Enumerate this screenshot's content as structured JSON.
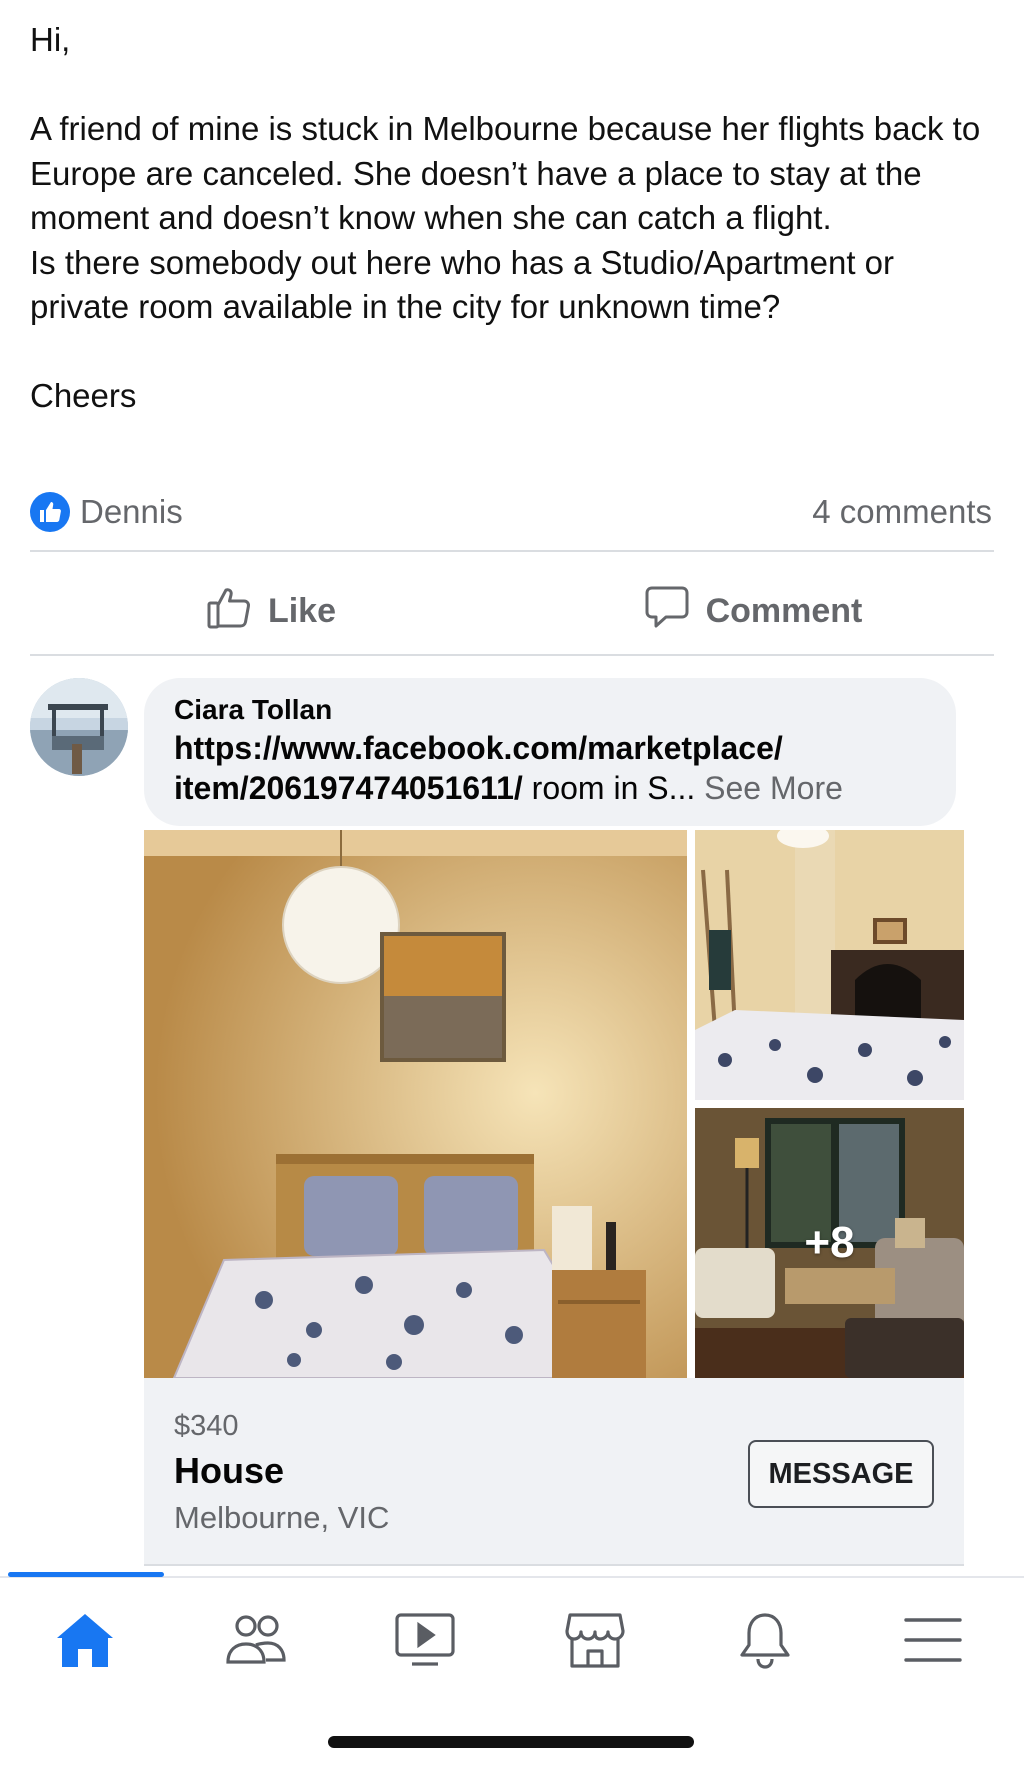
{
  "post": {
    "paragraphs": [
      "Hi,",
      "",
      "A friend of mine is stuck in Melbourne because her flights back to Europe are canceled. She doesn’t have a place to stay at the moment and doesn’t know when she can catch a flight.",
      "Is there somebody out here who has a Studio/Apartment or private room available in the city for unknown time?",
      "",
      "Cheers"
    ]
  },
  "reactions": {
    "reactor": "Dennis",
    "comment_count": "4 comments"
  },
  "actions": {
    "like_label": "Like",
    "comment_label": "Comment"
  },
  "comment": {
    "author": "Ciara Tollan",
    "link_line1": "https://www.facebook.com/marketplace/",
    "link_line2": "item/206197474051611/",
    "snippet": " room in S...",
    "see_more": "See More"
  },
  "gallery": {
    "more_count": "+8"
  },
  "listing": {
    "price": "$340",
    "title": "House",
    "location": "Melbourne, VIC",
    "message_label": "MESSAGE"
  },
  "tabbar": {
    "active_color": "#1877f2",
    "icons": [
      "home-icon",
      "friends-icon",
      "watch-icon",
      "marketplace-icon",
      "notifications-icon",
      "menu-icon"
    ]
  }
}
